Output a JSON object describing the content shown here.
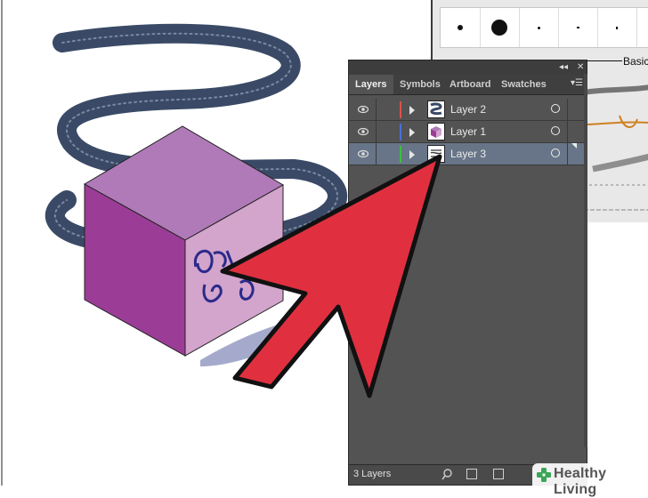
{
  "brushes_panel": {
    "basic_label": "Basic"
  },
  "layers_panel": {
    "tabs": [
      {
        "label": "Layers"
      },
      {
        "label": "Symbols"
      },
      {
        "label": "Artboard"
      },
      {
        "label": "Swatches"
      }
    ],
    "collapse_icon": "double-chevron-icon",
    "close_icon": "close-icon",
    "menu_icon": "panel-menu-icon",
    "layers": [
      {
        "name": "Layer 2",
        "color": "#d9534f",
        "thumb": "rope"
      },
      {
        "name": "Layer 1",
        "color": "#4a6fd8",
        "thumb": "cube"
      },
      {
        "name": "Layer 3",
        "color": "#3fbf3f",
        "thumb": "scribble",
        "selected": true
      }
    ],
    "count_label": "3 Layers"
  },
  "watermark": {
    "brand": "Healthy Living"
  },
  "colors": {
    "panel_bg": "#535353",
    "selected_row": "#687588",
    "arrow_red": "#e03040",
    "cube_top": "#b07ab8",
    "cube_left": "#9b3d96",
    "cube_right": "#d3a4cc",
    "rope": "#3a4a66"
  }
}
